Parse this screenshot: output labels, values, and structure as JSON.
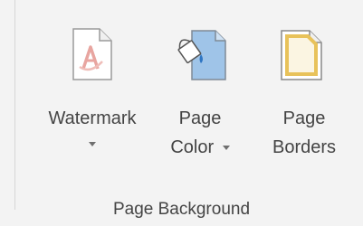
{
  "group": {
    "label": "Page Background"
  },
  "buttons": {
    "watermark": {
      "label": "Watermark",
      "icon": "watermark-icon",
      "has_dropdown": true
    },
    "page_color": {
      "label_line1": "Page",
      "label_line2": "Color",
      "icon": "page-color-icon",
      "has_dropdown": true
    },
    "page_borders": {
      "label_line1": "Page",
      "label_line2": "Borders",
      "icon": "page-borders-icon",
      "has_dropdown": false
    }
  },
  "colors": {
    "ribbon_background": "#f3f3f3",
    "text": "#444444",
    "watermark_glyph": "#e8a5a0",
    "page_color_fill": "#9fc4e8",
    "page_border_gold": "#e8c25a"
  }
}
